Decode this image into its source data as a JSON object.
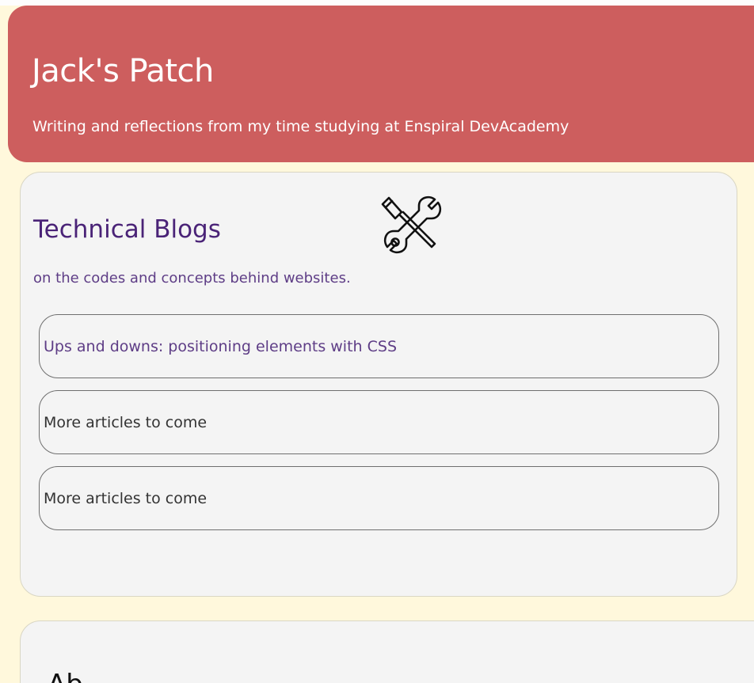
{
  "header": {
    "title": "Jack's Patch",
    "subtitle": "Writing and reflections from my time studying at Enspiral DevAcademy"
  },
  "technical_blogs": {
    "title": "Technical Blogs",
    "subtitle": "on the codes and concepts behind websites.",
    "icon": "tools-icon",
    "articles": [
      {
        "label": "Ups and downs: positioning elements with CSS"
      },
      {
        "label": "More articles to come"
      },
      {
        "label": "More articles to come"
      }
    ]
  },
  "about": {
    "title": "Ab"
  },
  "colors": {
    "page_background": "#fff8dc",
    "header_background": "#cd5e5e",
    "card_background": "#f4f4f4",
    "accent_purple": "#4a2377"
  }
}
